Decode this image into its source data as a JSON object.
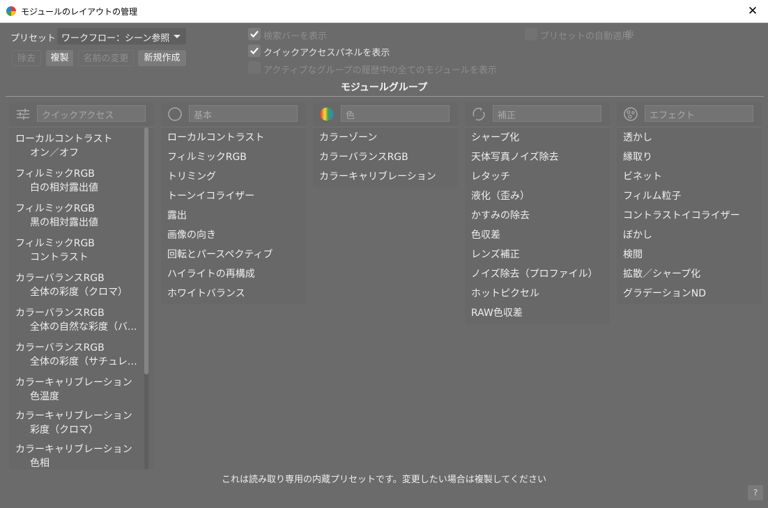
{
  "window": {
    "title": "モジュールのレイアウトの管理",
    "close_glyph": "✕"
  },
  "preset": {
    "label": "プリセット：",
    "selected": "ワークフロー：シーン参照"
  },
  "buttons": {
    "remove": "除去",
    "duplicate": "複製",
    "rename": "名前の変更",
    "new": "新規作成"
  },
  "options": {
    "show_search": {
      "label": "検索バーを表示",
      "checked": true
    },
    "show_quick": {
      "label": "クイックアクセスパネルを表示",
      "checked": true
    },
    "show_all_history": {
      "label": "アクティブなグループの履歴中の全てのモジュールを表示",
      "checked": false
    },
    "auto_apply": {
      "label": "プリセットの自動適用",
      "checked": false
    }
  },
  "section_title": "モジュールグループ",
  "groups": {
    "quick": {
      "name": "クイックアクセス",
      "icon": "sliders-icon",
      "items": [
        {
          "main": "ローカルコントラスト",
          "sub": "オン／オフ"
        },
        {
          "main": "フィルミックRGB",
          "sub": "白の相対露出値"
        },
        {
          "main": "フィルミックRGB",
          "sub": "黒の相対露出値"
        },
        {
          "main": "フィルミックRGB",
          "sub": "コントラスト"
        },
        {
          "main": "カラーバランスRGB",
          "sub": "全体の彩度（クロマ）"
        },
        {
          "main": "カラーバランスRGB",
          "sub": "全体の自然な彩度（バ..."
        },
        {
          "main": "カラーバランスRGB",
          "sub": "全体の彩度（サチュレー..."
        },
        {
          "main": "カラーキャリブレーション",
          "sub": "色温度"
        },
        {
          "main": "カラーキャリブレーション",
          "sub": "彩度（クロマ）"
        },
        {
          "main": "カラーキャリブレーション",
          "sub": "色相"
        }
      ]
    },
    "basic": {
      "name": "基本",
      "icon": "circle-icon",
      "items": [
        "ローカルコントラスト",
        "フィルミックRGB",
        "トリミング",
        "トーンイコライザー",
        "露出",
        "画像の向き",
        "回転とパースペクティブ",
        "ハイライトの再構成",
        "ホワイトバランス"
      ]
    },
    "color": {
      "name": "色",
      "icon": "color-wheel-icon",
      "items": [
        "カラーゾーン",
        "カラーバランスRGB",
        "カラーキャリブレーション"
      ]
    },
    "correct": {
      "name": "補正",
      "icon": "refresh-circle-icon",
      "items": [
        "シャープ化",
        "天体写真ノイズ除去",
        "レタッチ",
        "液化（歪み）",
        "かすみの除去",
        "色収差",
        "レンズ補正",
        "ノイズ除去（プロファイル）",
        "ホットピクセル",
        "RAW色収差"
      ]
    },
    "effect": {
      "name": "エフェクト",
      "icon": "effects-icon",
      "items": [
        "透かし",
        "縁取り",
        "ビネット",
        "フィルム粒子",
        "コントラストイコライザー",
        "ぼかし",
        "検閲",
        "拡散／シャープ化",
        "グラデーションND"
      ]
    }
  },
  "footer": "これは読み取り専用の内蔵プリセットです。変更したい場合は複製してください",
  "help": "?"
}
